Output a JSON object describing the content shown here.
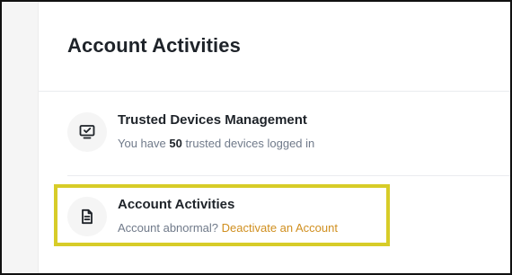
{
  "header": {
    "title": "Account Activities"
  },
  "items": [
    {
      "title": "Trusted Devices Management",
      "desc_prefix": "You have ",
      "desc_count": "50",
      "desc_suffix": " trusted devices logged in",
      "icon": "monitor-check-icon"
    },
    {
      "title": "Account Activities",
      "desc_prefix": "Account abnormal? ",
      "desc_link": "Deactivate an Account",
      "icon": "document-icon"
    }
  ],
  "colors": {
    "title_text": "#1e2329",
    "secondary_text": "#707a8a",
    "link": "#d08f1f",
    "highlight": "#d7cc28",
    "icon_bg": "#f5f5f5"
  }
}
